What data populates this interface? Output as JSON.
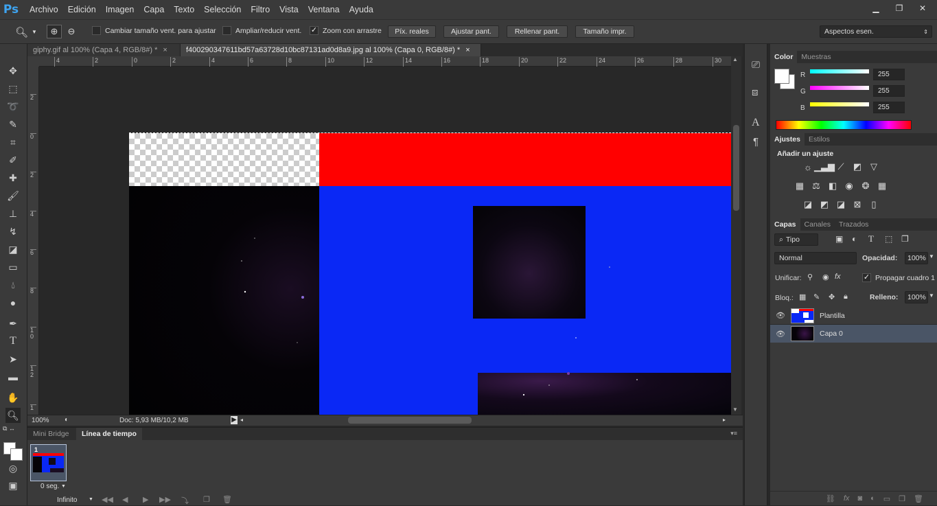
{
  "app": {
    "logo": "Ps"
  },
  "menu": [
    "Archivo",
    "Edición",
    "Imagen",
    "Capa",
    "Texto",
    "Selección",
    "Filtro",
    "Vista",
    "Ventana",
    "Ayuda"
  ],
  "window_controls": {
    "minimize": "▁",
    "restore": "❐",
    "close": "✕"
  },
  "options": {
    "cb_resize": "Cambiar tamaño vent. para ajustar",
    "cb_zoom_all": "Ampliar/reducir vent.",
    "cb_scrubby": "Zoom con arrastre",
    "btn_actual": "Píx. reales",
    "btn_fit": "Ajustar pant.",
    "btn_fill": "Rellenar pant.",
    "btn_print": "Tamaño impr.",
    "workspace": "Aspectos esen."
  },
  "tabs": [
    {
      "label": "giphy.gif al 100% (Capa 4, RGB/8#) *",
      "close": "×"
    },
    {
      "label": "f400290347611bd57a63728d10bc87131ad0d8a9.jpg al 100% (Capa 0, RGB/8#) *",
      "close": "×"
    }
  ],
  "ruler_h": [
    "4",
    "2",
    "0",
    "2",
    "4",
    "6",
    "8",
    "10",
    "12",
    "14",
    "16",
    "18",
    "20",
    "22",
    "24",
    "26",
    "28",
    "30"
  ],
  "ruler_v": [
    "2",
    "0",
    "2",
    "4",
    "6",
    "8",
    "1 0",
    "1 2",
    "1"
  ],
  "status": {
    "zoom": "100%",
    "doc": "Doc: 5,93 MB/10,2 MB"
  },
  "timeline": {
    "tab_bridge": "Mini Bridge",
    "tab_timeline": "Línea de tiempo",
    "frame_number": "1",
    "frame_delay": "0 seg.",
    "loop": "Infinito"
  },
  "color_panel": {
    "tab_color": "Color",
    "tab_swatches": "Muestras",
    "r_label": "R",
    "g_label": "G",
    "b_label": "B",
    "r": "255",
    "g": "255",
    "b": "255"
  },
  "adjust_panel": {
    "tab_adjust": "Ajustes",
    "tab_styles": "Estilos",
    "heading": "Añadir un ajuste"
  },
  "layers_panel": {
    "tab_layers": "Capas",
    "tab_channels": "Canales",
    "tab_paths": "Trazados",
    "filter": "Tipo",
    "blend": "Normal",
    "opacity_label": "Opacidad:",
    "opacity": "100%",
    "unify_label": "Unificar:",
    "propagate": "Propagar cuadro 1",
    "lock_label": "Bloq.:",
    "fill_label": "Relleno:",
    "fill": "100%",
    "layers": [
      {
        "name": "Plantilla",
        "selected": false
      },
      {
        "name": "Capa 0",
        "selected": true
      }
    ]
  },
  "colors": {
    "accent_blue": "#0a28f5",
    "red": "#ff0000",
    "selection": "#4a5566"
  }
}
